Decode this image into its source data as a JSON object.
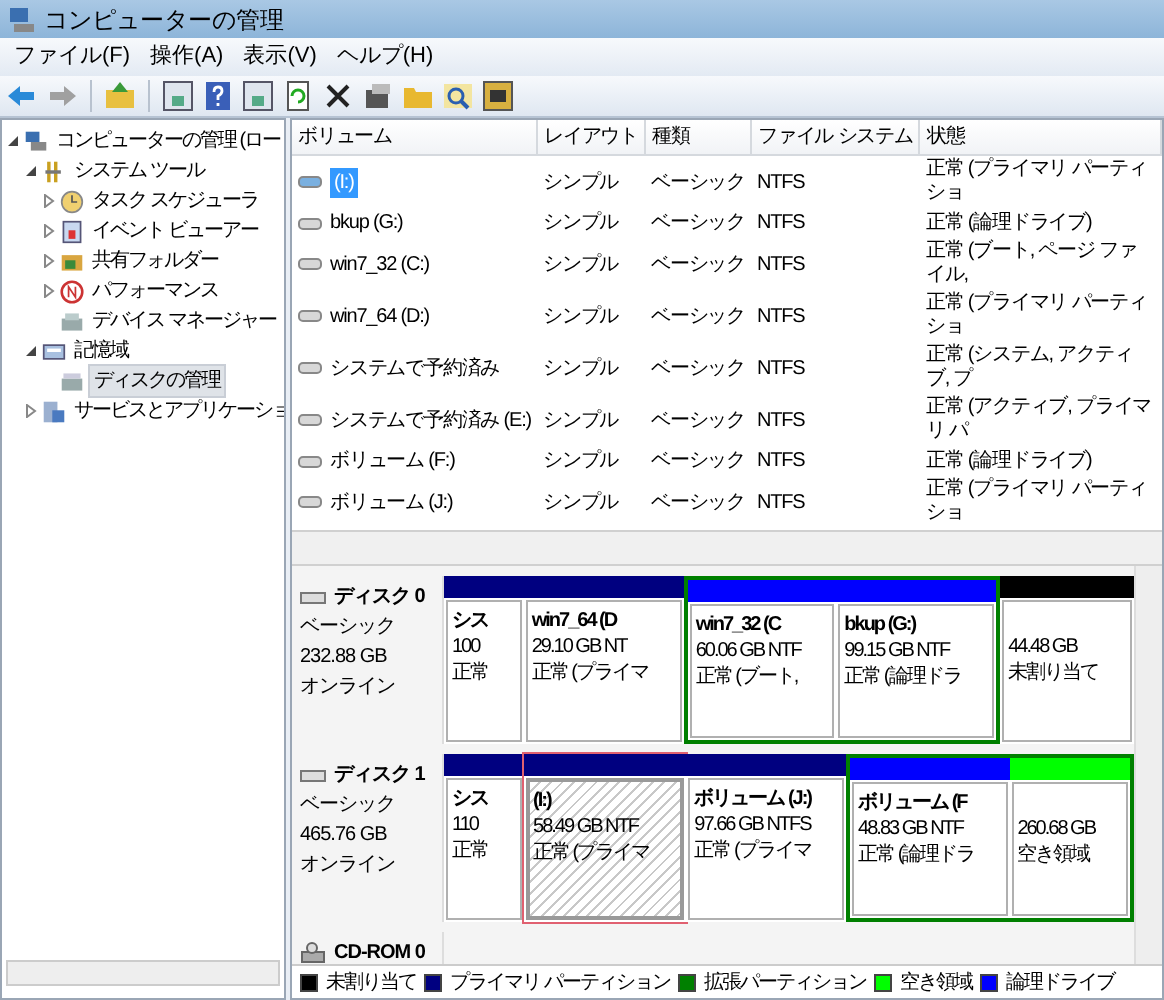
{
  "window": {
    "title": "コンピューターの管理"
  },
  "menu": [
    {
      "label": "ファイル(F)"
    },
    {
      "label": "操作(A)"
    },
    {
      "label": "表示(V)"
    },
    {
      "label": "ヘルプ(H)"
    }
  ],
  "tree": [
    {
      "label": "コンピューターの管理 (ロー",
      "selected": false,
      "expanded": true,
      "children": [
        {
          "label": "システム ツール",
          "selected": false,
          "expanded": true,
          "children": [
            {
              "label": "タスク スケジューラ",
              "selected": false,
              "expanded": false
            },
            {
              "label": "イベント ビューアー",
              "selected": false,
              "expanded": false
            },
            {
              "label": "共有フォルダー",
              "selected": false,
              "expanded": false
            },
            {
              "label": "パフォーマンス",
              "selected": false,
              "expanded": false
            },
            {
              "label": "デバイス マネージャー",
              "selected": false
            }
          ]
        },
        {
          "label": "記憶域",
          "selected": false,
          "expanded": true,
          "children": [
            {
              "label": "ディスクの管理",
              "selected": true
            }
          ]
        },
        {
          "label": "サービスとアプリケーショ",
          "selected": false,
          "expanded": false
        }
      ]
    }
  ],
  "volumes": {
    "columns": [
      "ボリューム",
      "レイアウト",
      "種類",
      "ファイル システム",
      "状態"
    ],
    "rows": [
      {
        "selected": true,
        "cells": [
          "(I:)",
          "シンプル",
          "ベーシック",
          "NTFS",
          "正常 (プライマリ パーティショ"
        ]
      },
      {
        "selected": false,
        "cells": [
          "bkup (G:)",
          "シンプル",
          "ベーシック",
          "NTFS",
          "正常 (論理ドライブ)"
        ]
      },
      {
        "selected": false,
        "cells": [
          "win7_32 (C:)",
          "シンプル",
          "ベーシック",
          "NTFS",
          "正常 (ブート, ページ ファイル,"
        ]
      },
      {
        "selected": false,
        "cells": [
          "win7_64 (D:)",
          "シンプル",
          "ベーシック",
          "NTFS",
          "正常 (プライマリ パーティショ"
        ]
      },
      {
        "selected": false,
        "cells": [
          "システムで予約済み",
          "シンプル",
          "ベーシック",
          "NTFS",
          "正常 (システム, アクティブ, プ"
        ]
      },
      {
        "selected": false,
        "cells": [
          "システムで予約済み (E:)",
          "シンプル",
          "ベーシック",
          "NTFS",
          "正常 (アクティブ, プライマリ パ"
        ]
      },
      {
        "selected": false,
        "cells": [
          "ボリューム (F:)",
          "シンプル",
          "ベーシック",
          "NTFS",
          "正常 (論理ドライブ)"
        ]
      },
      {
        "selected": false,
        "cells": [
          "ボリューム (J:)",
          "シンプル",
          "ベーシック",
          "NTFS",
          "正常 (プライマリ パーティショ"
        ]
      }
    ]
  },
  "disks": [
    {
      "kind": "disk",
      "name": "ディスク 0",
      "type": "ベーシック",
      "size": "232.88 GB",
      "status": "オンライン",
      "partitions": [
        {
          "name": "シス",
          "size": "100",
          "status": "正常",
          "color": "#000080",
          "extended": false,
          "selected": false
        },
        {
          "name": "win7_64 (D",
          "size": "29.10 GB NT",
          "status": "正常 (プライマ",
          "color": "#000080",
          "extended": false,
          "selected": false
        },
        {
          "name": "win7_32 (C",
          "size": "60.06 GB NTF",
          "status": "正常 (ブート,",
          "color": "#0000ff",
          "extended": true,
          "selected": false
        },
        {
          "name": "bkup (G:)",
          "size": "99.15 GB NTF",
          "status": "正常 (論理ドラ",
          "color": "#0000ff",
          "extended": true,
          "selected": false
        },
        {
          "size": "44.48 GB",
          "status": "未割り当て",
          "color": "#000000",
          "extended": false,
          "selected": false
        }
      ]
    },
    {
      "kind": "disk",
      "name": "ディスク 1",
      "type": "ベーシック",
      "size": "465.76 GB",
      "status": "オンライン",
      "partitions": [
        {
          "name": "シス",
          "size": "110",
          "status": "正常",
          "color": "#000080",
          "extended": false,
          "selected": false
        },
        {
          "name": "(I:)",
          "size": "58.49 GB NTF",
          "status": "正常 (プライマ",
          "color": "#000080",
          "extended": false,
          "selected": true
        },
        {
          "name": "ボリューム (J:)",
          "size": "97.66 GB NTFS",
          "status": "正常 (プライマ",
          "color": "#000080",
          "extended": false,
          "selected": false
        },
        {
          "name": "ボリューム (F",
          "size": "48.83 GB NTF",
          "status": "正常 (論理ドラ",
          "color": "#0000ff",
          "extended": true,
          "selected": false
        },
        {
          "size": "260.68 GB",
          "status": "空き領域",
          "color": "#00ff00",
          "extended": true,
          "selected": false
        }
      ]
    },
    {
      "kind": "cdrom",
      "name": "CD-ROM 0"
    }
  ],
  "legend": [
    {
      "label": "未割り当て",
      "color": "#000000"
    },
    {
      "label": "プライマリ パーティション",
      "color": "#000080"
    },
    {
      "label": "拡張パーティション",
      "color": "#008000"
    },
    {
      "label": "空き領域",
      "color": "#00ff00"
    },
    {
      "label": "論理ドライブ",
      "color": "#0000ff"
    }
  ]
}
